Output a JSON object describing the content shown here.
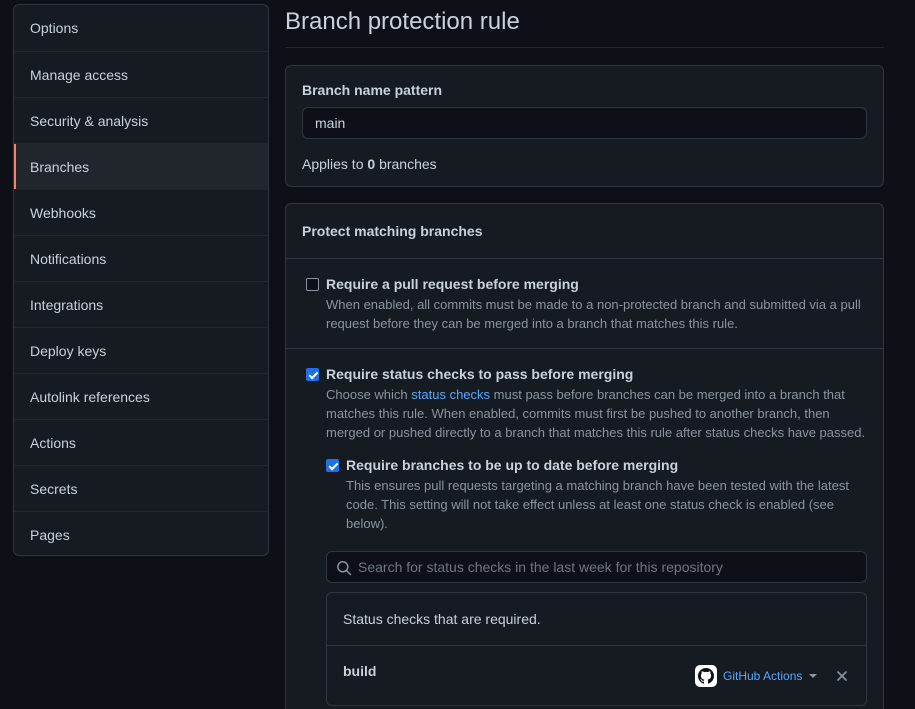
{
  "sidebar": {
    "items": [
      {
        "label": "Options"
      },
      {
        "label": "Manage access"
      },
      {
        "label": "Security & analysis"
      },
      {
        "label": "Branches",
        "active": true
      },
      {
        "label": "Webhooks"
      },
      {
        "label": "Notifications"
      },
      {
        "label": "Integrations"
      },
      {
        "label": "Deploy keys"
      },
      {
        "label": "Autolink references"
      },
      {
        "label": "Actions"
      },
      {
        "label": "Secrets"
      },
      {
        "label": "Pages"
      }
    ]
  },
  "main": {
    "title": "Branch protection rule",
    "pattern": {
      "label": "Branch name pattern",
      "value": "main",
      "applies_prefix": "Applies to",
      "applies_count": "0",
      "applies_suffix": "branches"
    },
    "protect": {
      "header": "Protect matching branches",
      "rules": {
        "pull_request": {
          "checked": false,
          "title": "Require a pull request before merging",
          "desc": "When enabled, all commits must be made to a non-protected branch and submitted via a pull request before they can be merged into a branch that matches this rule."
        },
        "status_checks": {
          "checked": true,
          "title": "Require status checks to pass before merging",
          "desc_before_link": "Choose which",
          "desc_link": "status checks",
          "desc_after_link": "must pass before branches can be merged into a branch that matches this rule. When enabled, commits must first be pushed to another branch, then merged or pushed directly to a branch that matches this rule after status checks have passed.",
          "up_to_date": {
            "checked": true,
            "title": "Require branches to be up to date before merging",
            "desc": "This ensures pull requests targeting a matching branch have been tested with the latest code. This setting will not take effect unless at least one status check is enabled (see below)."
          },
          "search_placeholder": "Search for status checks in the last week for this repository",
          "required_header": "Status checks that are required.",
          "checks": [
            {
              "name": "build",
              "app": "GitHub Actions"
            }
          ]
        }
      }
    }
  },
  "colors": {
    "background": "#0d1117",
    "panel": "#161b22",
    "border": "#30363d",
    "accent_active": "#f78166",
    "link": "#58a6ff",
    "checkbox": "#1f6feb"
  },
  "icons": {
    "search": "search-icon",
    "github": "github-mark-icon",
    "remove": "x-icon",
    "dropdown": "triangle-down-icon"
  }
}
